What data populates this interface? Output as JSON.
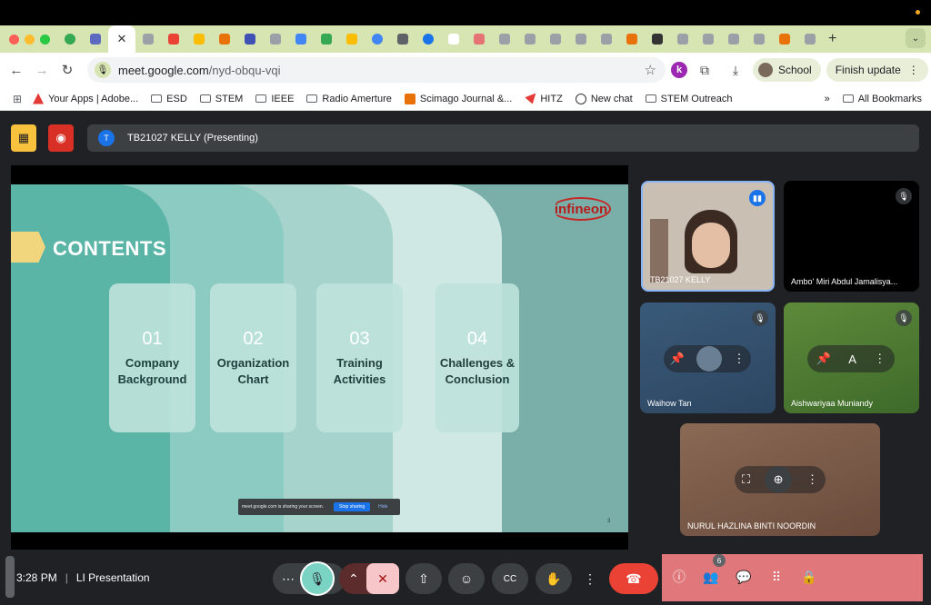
{
  "browser": {
    "tab_close": "✕",
    "url_host": "meet.google.com",
    "url_path": "/nyd-obqu-vqi",
    "profile_label": "School",
    "update_label": "Finish update",
    "bookmarks": [
      {
        "label": "Your Apps | Adobe...",
        "icon": "adobe-icon"
      },
      {
        "label": "ESD",
        "icon": "folder-icon"
      },
      {
        "label": "STEM",
        "icon": "folder-icon"
      },
      {
        "label": "IEEE",
        "icon": "folder-icon"
      },
      {
        "label": "Radio Amerture",
        "icon": "folder-icon"
      },
      {
        "label": "Scimago Journal &...",
        "icon": "sjr-icon"
      },
      {
        "label": "HITZ",
        "icon": "hitz-icon"
      },
      {
        "label": "New chat",
        "icon": "chat-icon"
      },
      {
        "label": "STEM Outreach",
        "icon": "folder-icon"
      }
    ],
    "all_bookmarks": "All Bookmarks",
    "more_bookmarks": "»"
  },
  "meet": {
    "presenting_initial": "T",
    "presenting_label": "TB21027 KELLY (Presenting)",
    "slide": {
      "title": "CONTENTS",
      "logo": "infineon",
      "cards": [
        {
          "num": "01",
          "label": "Company Background"
        },
        {
          "num": "02",
          "label": "Organization Chart"
        },
        {
          "num": "03",
          "label": "Training Activities"
        },
        {
          "num": "04",
          "label": "Challenges & Conclusion"
        }
      ],
      "share_notice": "meet.google.com is sharing your screen.",
      "stop_sharing": "Stop sharing",
      "hide": "Hide",
      "page_number": "3"
    },
    "participants": [
      {
        "name": "TB21027 KELLY",
        "state": "speaking"
      },
      {
        "name": "Ambo' Miri Abdul Jamalisya...",
        "state": "muted"
      },
      {
        "name": "Waihow Tan",
        "state": "muted"
      },
      {
        "name": "Aishwariyaa Muniandy",
        "state": "muted"
      },
      {
        "name": "NURUL HAZLINA BINTI NOORDIN",
        "state": "video"
      }
    ],
    "time": "3:28 PM",
    "meeting_name": "LI Presentation",
    "people_count": "6",
    "colors": {
      "accent_green": "#7bd3c4",
      "end_call": "#ea4335",
      "side_panel": "#e0787b",
      "slide_bg": "#7aaea8",
      "cam_off": "#f6c6c9"
    }
  }
}
